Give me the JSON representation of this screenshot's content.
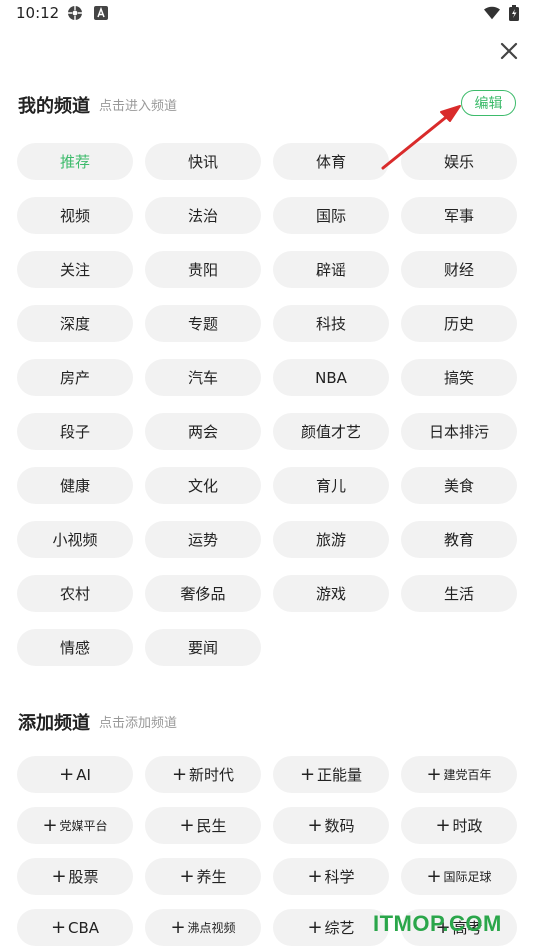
{
  "status": {
    "time": "10:12"
  },
  "my_channels": {
    "title": "我的频道",
    "hint": "点击进入频道",
    "edit_label": "编辑",
    "items": [
      "推荐",
      "快讯",
      "体育",
      "娱乐",
      "视频",
      "法治",
      "国际",
      "军事",
      "关注",
      "贵阳",
      "辟谣",
      "财经",
      "深度",
      "专题",
      "科技",
      "历史",
      "房产",
      "汽车",
      "NBA",
      "搞笑",
      "段子",
      "两会",
      "颜值才艺",
      "日本排污",
      "健康",
      "文化",
      "育儿",
      "美食",
      "小视频",
      "运势",
      "旅游",
      "教育",
      "农村",
      "奢侈品",
      "游戏",
      "生活",
      "情感",
      "要闻"
    ],
    "active_index": 0
  },
  "add_channels": {
    "title": "添加频道",
    "hint": "点击添加频道",
    "plus": "+",
    "items": [
      "AI",
      "新时代",
      "正能量",
      "建党百年",
      "党媒平台",
      "民生",
      "数码",
      "时政",
      "股票",
      "养生",
      "科学",
      "国际足球",
      "CBA",
      "沸点视频",
      "综艺",
      "高考"
    ]
  },
  "watermark": "ITMOP.COM",
  "colors": {
    "accent": "#3dbb6b",
    "arrow": "#d92b2b",
    "chip_bg": "#f2f2f2"
  },
  "icons": [
    "settings-icon",
    "a-icon",
    "wifi-icon",
    "battery-icon",
    "close-icon",
    "arrow-annotation"
  ]
}
